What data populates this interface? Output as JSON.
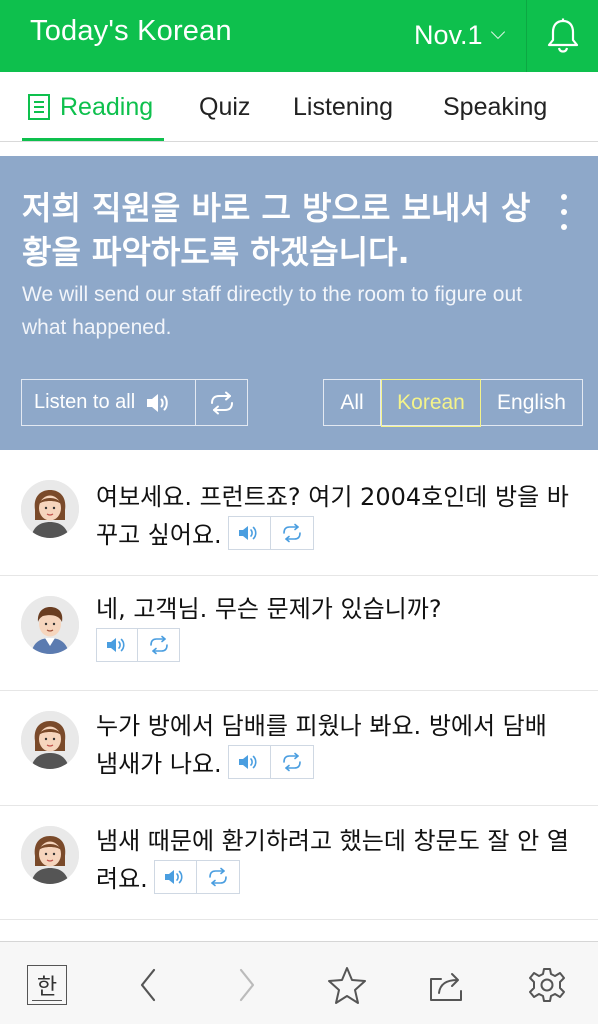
{
  "header": {
    "app_title": "Today's Korean",
    "date": "Nov.1"
  },
  "tabs": [
    {
      "label": "Reading",
      "active": true
    },
    {
      "label": "Quiz",
      "active": false
    },
    {
      "label": "Listening",
      "active": false
    },
    {
      "label": "Speaking",
      "active": false
    }
  ],
  "sentence": {
    "korean": "저희 직원을 바로 그 방으로 보내서 상황을 파악하도록 하겠습니다.",
    "english": "We will send our staff directly to the room to figure out what happened.",
    "listen_all_label": "Listen to all",
    "language_options": [
      "All",
      "Korean",
      "English"
    ],
    "selected_language": "Korean"
  },
  "dialogue": [
    {
      "speaker": "woman",
      "text": "여보세요. 프런트죠? 여기 2004호인데 방을 바꾸고 싶어요."
    },
    {
      "speaker": "man",
      "text": "네, 고객님. 무슨 문제가 있습니까?"
    },
    {
      "speaker": "woman",
      "text": "누가 방에서 담배를 피웠나 봐요. 방에서 담배 냄새가 나요."
    },
    {
      "speaker": "woman",
      "text": "냄새 때문에 환기하려고 했는데 창문도 잘 안 열려요."
    }
  ],
  "bottom_bar": {
    "korean_key_label": "한",
    "icons": [
      "korean-key-icon",
      "back-arrow-icon",
      "forward-arrow-icon",
      "star-icon",
      "share-icon",
      "settings-icon"
    ]
  },
  "colors": {
    "brand_green": "#0ec04d",
    "panel_blue": "#8ea8c9",
    "selected_language": "#f4f38a",
    "control_icon_blue": "#4a9ee0"
  }
}
